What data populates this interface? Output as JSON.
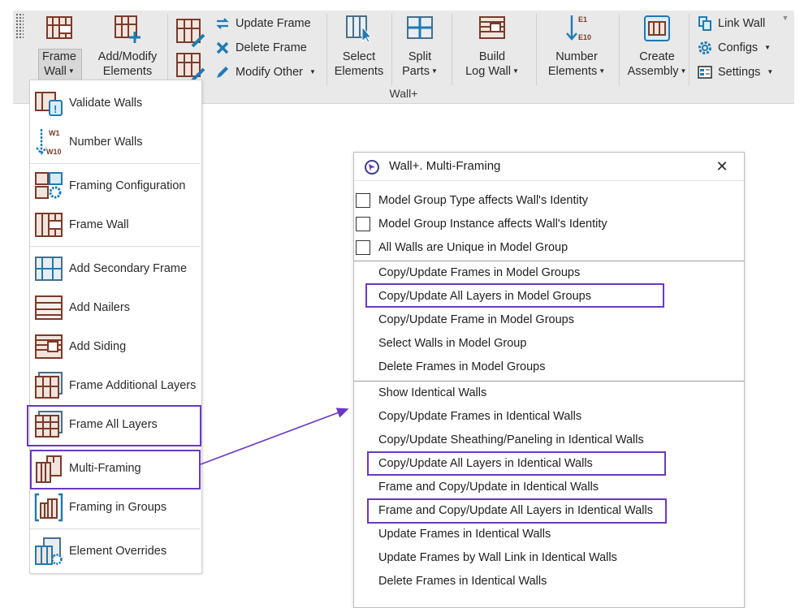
{
  "colors": {
    "highlight": "#6a38c2",
    "ribbon_bg": "#e9e9e9",
    "accent_blue": "#1f7ab3"
  },
  "ribbon": {
    "panel_label": "Wall+",
    "frame_wall": {
      "line1": "Frame",
      "line2": "Wall",
      "icon": "frame-wall-icon"
    },
    "add_modify": {
      "line1": "Add/Modify",
      "line2": "Elements",
      "icon": "add-modify-elements-icon"
    },
    "update_frame": {
      "label": "Update Frame",
      "icon": "refresh-arrows-icon"
    },
    "delete_frame": {
      "label": "Delete Frame",
      "icon": "blue-x-icon"
    },
    "modify_other": {
      "label": "Modify Other",
      "icon": "pencil-icon"
    },
    "select_elements": {
      "line1": "Select",
      "line2": "Elements",
      "icon": "select-cursor-icon"
    },
    "split_parts": {
      "line1": "Split",
      "line2": "Parts",
      "icon": "split-parts-icon"
    },
    "build_log_wall": {
      "line1": "Build",
      "line2": "Log Wall",
      "icon": "log-wall-icon"
    },
    "number_elements": {
      "line1": "Number",
      "line2": "Elements",
      "icon": "number-elements-icon",
      "top_label": "E1",
      "bottom_label": "E10"
    },
    "create_assembly": {
      "line1": "Create",
      "line2": "Assembly",
      "icon": "assembly-icon"
    },
    "link_wall": {
      "label": "Link Wall",
      "icon": "link-icon"
    },
    "configs": {
      "label": "Configs",
      "icon": "gear-icon"
    },
    "settings": {
      "label": "Settings",
      "icon": "settings-panel-icon"
    }
  },
  "dropdown": {
    "items": [
      {
        "label": "Validate Walls",
        "icon": "validate-walls-icon"
      },
      {
        "label": "Number Walls",
        "icon": "number-walls-icon",
        "top_label": "W1",
        "bottom_label": "W10"
      },
      {
        "label": "Framing Configuration",
        "icon": "framing-configuration-icon"
      },
      {
        "label": "Frame Wall",
        "icon": "frame-wall-icon"
      },
      {
        "label": "Add Secondary Frame",
        "icon": "secondary-frame-icon"
      },
      {
        "label": "Add Nailers",
        "icon": "nailers-icon"
      },
      {
        "label": "Add Siding",
        "icon": "siding-icon"
      },
      {
        "label": "Frame Additional Layers",
        "icon": "additional-layers-icon"
      },
      {
        "label": "Frame All Layers",
        "icon": "all-layers-icon"
      },
      {
        "label": "Multi-Framing",
        "icon": "multi-framing-icon"
      },
      {
        "label": "Framing in Groups",
        "icon": "framing-in-groups-icon"
      },
      {
        "label": "Element Overrides",
        "icon": "element-overrides-icon"
      }
    ]
  },
  "dialog": {
    "title": "Wall+. Multi-Framing",
    "checkboxes": [
      {
        "label": "Model Group Type affects Wall's Identity",
        "checked": false
      },
      {
        "label": "Model Group Instance affects Wall's Identity",
        "checked": false
      },
      {
        "label": "All Walls are Unique in Model Group",
        "checked": false
      }
    ],
    "group_items": [
      "Copy/Update Frames in Model Groups",
      "Copy/Update All Layers in Model Groups",
      "Copy/Update Frame in Model Groups",
      "Select Walls in Model Group",
      "Delete Frames in Model Groups"
    ],
    "identical_items": [
      "Show Identical Walls",
      "Copy/Update Frames in Identical Walls",
      "Copy/Update Sheathing/Paneling in Identical Walls",
      "Copy/Update All Layers in Identical Walls",
      "Frame and Copy/Update in Identical Walls",
      "Frame and Copy/Update All Layers in Identical Walls",
      "Update Frames  in  Identical  Walls",
      "Update Frames by Wall Link in Identical Walls",
      "Delete Frames in Identical Walls"
    ]
  }
}
